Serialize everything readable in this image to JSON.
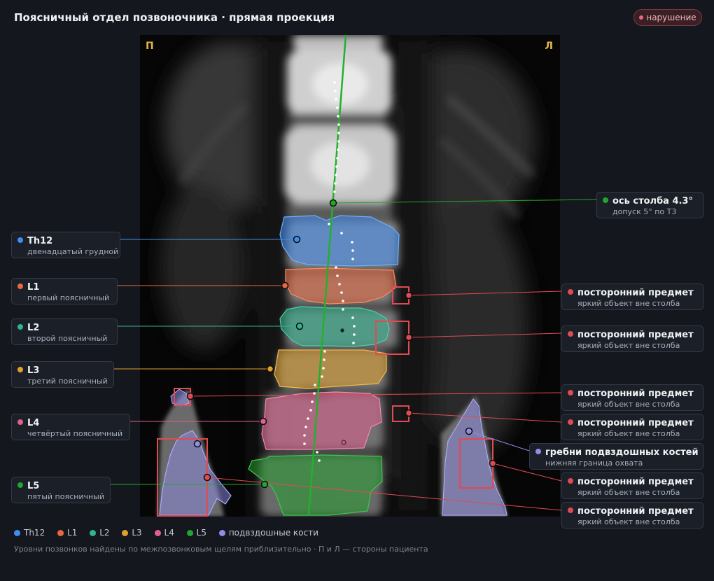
{
  "header": {
    "title": "Поясничный отдел позвоночника · прямая проекция",
    "status_badge": "нарушение"
  },
  "viewer": {
    "side_right": "П",
    "side_left": "Л"
  },
  "colors": {
    "th12": "#3f8df0",
    "l1": "#e8683f",
    "l2": "#2fb58e",
    "l3": "#e0a12c",
    "l4": "#e0608f",
    "l5": "#22a52d",
    "iliac": "#8f8ee8",
    "foreign": "#e04a52"
  },
  "labels": {
    "th12": {
      "title": "Th12",
      "subtitle": "двенадцатый грудной"
    },
    "l1": {
      "title": "L1",
      "subtitle": "первый поясничный"
    },
    "l2": {
      "title": "L2",
      "subtitle": "второй поясничный"
    },
    "l3": {
      "title": "L3",
      "subtitle": "третий поясничный"
    },
    "l4": {
      "title": "L4",
      "subtitle": "четвёртый поясничный"
    },
    "l5": {
      "title": "L5",
      "subtitle": "пятый поясничный"
    },
    "axis": {
      "title": "ось столба 4.3°",
      "subtitle": "допуск 5° по Т3"
    },
    "iliac": {
      "title": "гребни подвздошных костей",
      "subtitle": "нижняя граница охвата"
    },
    "foreign": [
      {
        "title": "посторонний предмет",
        "subtitle": "яркий объект вне столба"
      },
      {
        "title": "посторонний предмет",
        "subtitle": "яркий объект вне столба"
      },
      {
        "title": "посторонний предмет",
        "subtitle": "яркий объект вне столба"
      },
      {
        "title": "посторонний предмет",
        "subtitle": "яркий объект вне столба"
      },
      {
        "title": "посторонний предмет",
        "subtitle": "яркий объект вне столба"
      },
      {
        "title": "посторонний предмет",
        "subtitle": "яркий объект вне столба"
      }
    ]
  },
  "legend": {
    "th12": "Th12",
    "l1": "L1",
    "l2": "L2",
    "l3": "L3",
    "l4": "L4",
    "l5": "L5",
    "iliac": "подвздошные кости"
  },
  "footnote": "Уровни позвонков найдены по межпозвонковым щелям приблизительно · П и Л — стороны пациента"
}
